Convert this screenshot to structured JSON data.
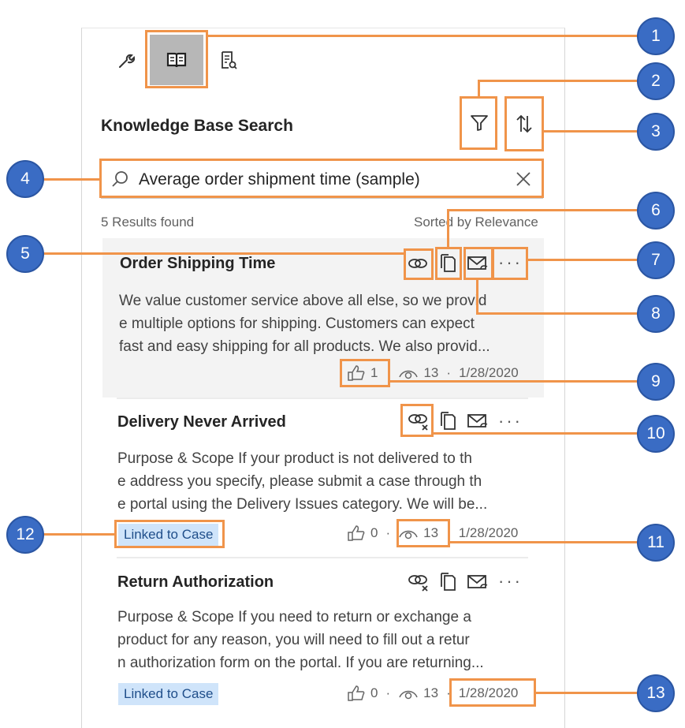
{
  "panel": {
    "tabs": [
      {
        "name": "tools",
        "icon": "wrench-icon"
      },
      {
        "name": "knowledge",
        "icon": "book-icon",
        "active": true
      },
      {
        "name": "notes",
        "icon": "document-search-icon"
      }
    ],
    "title": "Knowledge Base Search",
    "search": {
      "value": "Average order shipment time (sample)"
    },
    "results_count": "5 Results found",
    "sorted_by": "Sorted by Relevance"
  },
  "articles": [
    {
      "title": "Order Shipping Time",
      "lines": [
        "We value customer service above all else, so we provid",
        "e multiple options for shipping. Customers can expect",
        "fast and easy shipping for all products. We also provid..."
      ],
      "likes": "1",
      "views": "13",
      "date": "1/28/2020",
      "linked_label": ""
    },
    {
      "title": "Delivery Never Arrived",
      "lines": [
        "Purpose & Scope If your product is not delivered to th",
        "e address you specify, please submit a case through th",
        "e portal using the Delivery Issues category. We will be..."
      ],
      "likes": "0",
      "views": "13",
      "date": "1/28/2020",
      "linked_label": "Linked to Case"
    },
    {
      "title": "Return Authorization",
      "lines": [
        "Purpose & Scope If you need to return or exchange a",
        "product for any reason, you will need to fill out a retur",
        "n authorization form on the portal. If you are returning..."
      ],
      "likes": "0",
      "views": "13",
      "date": "1/28/2020",
      "linked_label": "Linked to Case"
    }
  ],
  "callouts": [
    "1",
    "2",
    "3",
    "4",
    "5",
    "6",
    "7",
    "8",
    "9",
    "10",
    "11",
    "12",
    "13"
  ],
  "colors": {
    "highlight": "#f0944a",
    "badge": "#3a6cc4",
    "linked_bg": "#cfe4fa"
  }
}
